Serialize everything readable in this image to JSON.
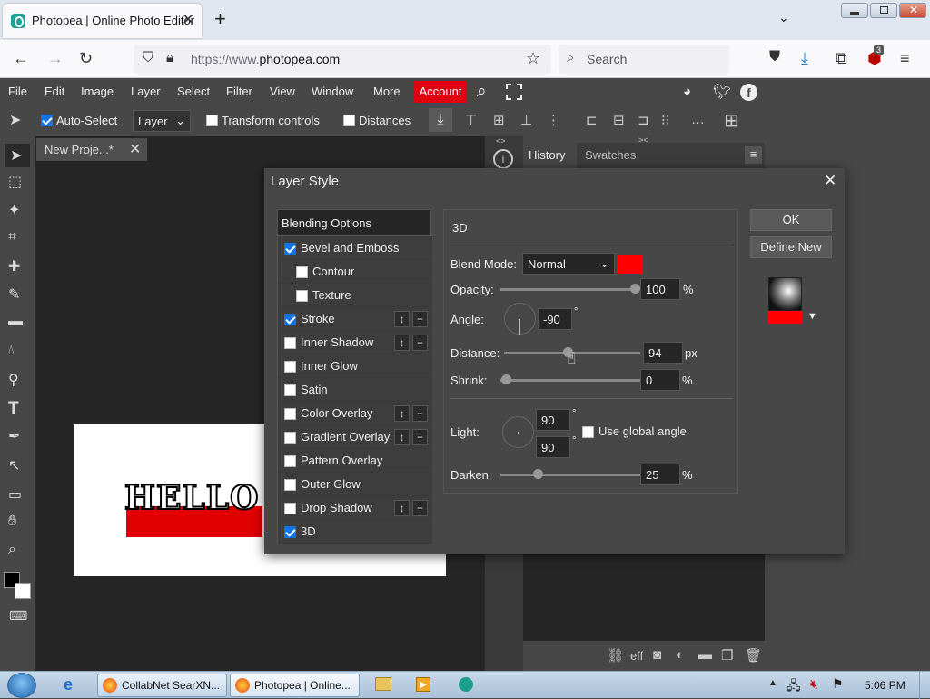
{
  "browser": {
    "tab_title": "Photopea | Online Photo Editor",
    "url_prefix": "https://www.",
    "url_domain": "photopea.com",
    "search_placeholder": "Search",
    "ext_badge": "3"
  },
  "menu": [
    "File",
    "Edit",
    "Image",
    "Layer",
    "Select",
    "Filter",
    "View",
    "Window",
    "More"
  ],
  "menu_account": "Account",
  "options": {
    "auto_select": "Auto-Select",
    "layer_value": "Layer",
    "transform_controls": "Transform controls",
    "distances": "Distances"
  },
  "document": {
    "tab": "New Proje...*"
  },
  "canvas_text": "HELLO",
  "panels": {
    "history": "History",
    "swatches": "Swatches"
  },
  "dialog": {
    "title": "Layer Style",
    "ok": "OK",
    "define_new": "Define New",
    "blending_options": "Blending Options",
    "styles": [
      {
        "label": "Bevel and Emboss",
        "checked": true,
        "indent": false,
        "controls": false
      },
      {
        "label": "Contour",
        "checked": false,
        "indent": true,
        "controls": false
      },
      {
        "label": "Texture",
        "checked": false,
        "indent": true,
        "controls": false
      },
      {
        "label": "Stroke",
        "checked": true,
        "indent": false,
        "controls": true
      },
      {
        "label": "Inner Shadow",
        "checked": false,
        "indent": false,
        "controls": true
      },
      {
        "label": "Inner Glow",
        "checked": false,
        "indent": false,
        "controls": false
      },
      {
        "label": "Satin",
        "checked": false,
        "indent": false,
        "controls": false
      },
      {
        "label": "Color Overlay",
        "checked": false,
        "indent": false,
        "controls": true
      },
      {
        "label": "Gradient Overlay",
        "checked": false,
        "indent": false,
        "controls": true
      },
      {
        "label": "Pattern Overlay",
        "checked": false,
        "indent": false,
        "controls": false
      },
      {
        "label": "Outer Glow",
        "checked": false,
        "indent": false,
        "controls": false
      },
      {
        "label": "Drop Shadow",
        "checked": false,
        "indent": false,
        "controls": true
      },
      {
        "label": "3D",
        "checked": true,
        "indent": false,
        "controls": false
      }
    ],
    "section": "3D",
    "blend_mode_label": "Blend Mode:",
    "blend_mode": "Normal",
    "blend_color": "#ff0000",
    "opacity_label": "Opacity:",
    "opacity": "100",
    "angle_label": "Angle:",
    "angle": "-90",
    "distance_label": "Distance:",
    "distance": "94",
    "shrink_label": "Shrink:",
    "shrink": "0",
    "light_label": "Light:",
    "light_1": "90",
    "light_2": "90",
    "use_global_angle": "Use global angle",
    "darken_label": "Darken:",
    "darken": "25",
    "unit_percent": "%",
    "unit_px": "px",
    "unit_deg": "°"
  },
  "taskbar": {
    "items": [
      "CollabNet SearXN...",
      "Photopea | Online..."
    ],
    "clock": "5:06 PM"
  }
}
